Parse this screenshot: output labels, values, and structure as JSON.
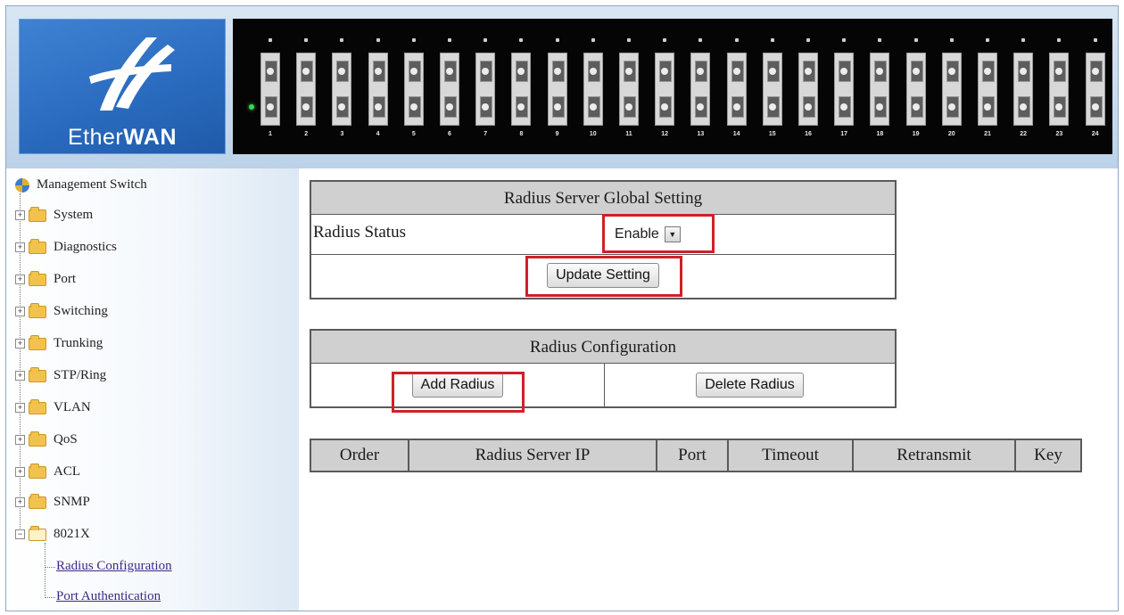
{
  "brand": {
    "logo_text_pre": "Ether",
    "logo_text_bold": "WAN"
  },
  "panel": {
    "ports": [
      "1",
      "2",
      "3",
      "4",
      "5",
      "6",
      "7",
      "8",
      "9",
      "10",
      "11",
      "12",
      "13",
      "14",
      "15",
      "16",
      "17",
      "18",
      "19",
      "20",
      "21",
      "22",
      "23",
      "24"
    ]
  },
  "sidebar": {
    "root": "Management Switch",
    "items": [
      {
        "label": "System",
        "expanded": false
      },
      {
        "label": "Diagnostics",
        "expanded": false
      },
      {
        "label": "Port",
        "expanded": false
      },
      {
        "label": "Switching",
        "expanded": false
      },
      {
        "label": "Trunking",
        "expanded": false
      },
      {
        "label": "STP/Ring",
        "expanded": false
      },
      {
        "label": "VLAN",
        "expanded": false
      },
      {
        "label": "QoS",
        "expanded": false
      },
      {
        "label": "ACL",
        "expanded": false
      },
      {
        "label": "SNMP",
        "expanded": false
      },
      {
        "label": "8021X",
        "expanded": true
      }
    ],
    "subitems": [
      "Radius Configuration",
      "Port Authentication"
    ]
  },
  "global": {
    "title": "Radius Server Global Setting",
    "status_label": "Radius Status",
    "status_value": "Enable",
    "update_button": "Update Setting"
  },
  "config": {
    "title": "Radius Configuration",
    "add_button": "Add Radius",
    "delete_button": "Delete Radius"
  },
  "servers": {
    "columns": [
      "Order",
      "Radius Server IP",
      "Port",
      "Timeout",
      "Retransmit",
      "Key"
    ]
  },
  "colors": {
    "highlight": "#d0202a",
    "logo_blue": "#2b6cc0",
    "link": "#3c2a88"
  }
}
